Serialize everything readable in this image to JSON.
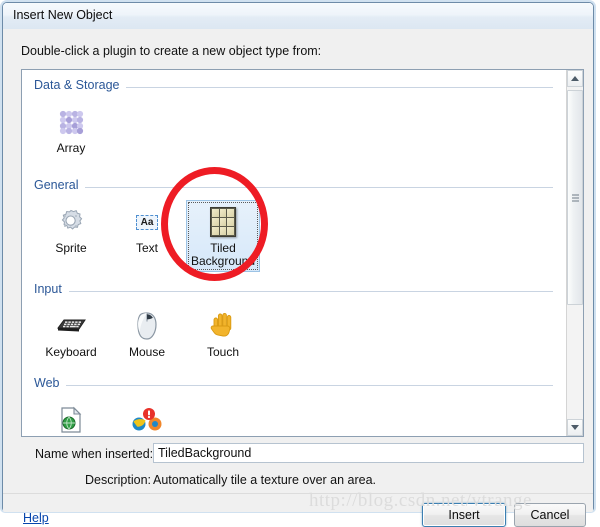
{
  "window": {
    "title": "Insert New Object"
  },
  "prompt": {
    "label": "Double-click a plugin to create a new object type from:"
  },
  "search": {
    "icon": "search-icon",
    "value": "",
    "placeholder": ""
  },
  "groups": [
    {
      "title": "Data & Storage",
      "items": [
        {
          "label": "Array",
          "icon": "array-spheres-icon",
          "selected": false
        }
      ]
    },
    {
      "title": "General",
      "items": [
        {
          "label": "Sprite",
          "icon": "gear-icon",
          "selected": false
        },
        {
          "label": "Text",
          "icon": "text-aa-icon",
          "selected": false
        },
        {
          "label": "Tiled Background",
          "icon": "tiled-grid-icon",
          "selected": true
        }
      ]
    },
    {
      "title": "Input",
      "items": [
        {
          "label": "Keyboard",
          "icon": "keyboard-icon",
          "selected": false
        },
        {
          "label": "Mouse",
          "icon": "mouse-icon",
          "selected": false
        },
        {
          "label": "Touch",
          "icon": "hand-touch-icon",
          "selected": false
        }
      ]
    },
    {
      "title": "Web",
      "items": [
        {
          "label": "",
          "icon": "page-globe-icon",
          "selected": false
        },
        {
          "label": "",
          "icon": "browsers-icon",
          "selected": false
        }
      ]
    }
  ],
  "name_field": {
    "label": "Name when inserted:",
    "value": "TiledBackground"
  },
  "description": {
    "label": "Description:",
    "value": "Automatically tile a texture over an area."
  },
  "footer": {
    "help_label": "Help",
    "insert_label": "Insert",
    "cancel_label": "Cancel"
  },
  "annotation": {
    "shape": "red-circle",
    "color": "#ee1c24",
    "target": "Tiled Background"
  },
  "watermark": {
    "text": "http://blog.csdn.net/vtrange"
  },
  "colors": {
    "group_title": "#2b5797",
    "selection": "#d6e8f9",
    "link": "#0645ad",
    "annotation": "#ee1c24"
  }
}
